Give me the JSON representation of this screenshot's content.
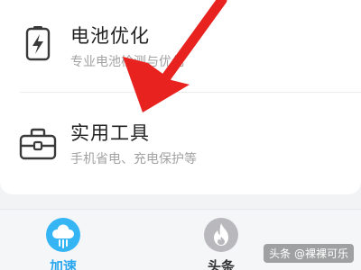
{
  "list": {
    "items": [
      {
        "title": "电池优化",
        "subtitle": "专业电池检测与优化",
        "icon": "battery-bolt-icon"
      },
      {
        "title": "实用工具",
        "subtitle": "手机省电、充电保护等",
        "icon": "toolbox-icon"
      }
    ]
  },
  "tabbar": {
    "tabs": [
      {
        "label": "加速",
        "icon": "rocket-cloud-icon",
        "active": true
      },
      {
        "label": "头条",
        "icon": "flame-icon",
        "active": false
      }
    ]
  },
  "annotation": {
    "arrow_color": "#e8231f"
  },
  "watermark": {
    "text": "头条 @裸裸可乐"
  },
  "colors": {
    "accent": "#2aa7ee",
    "title": "#222222",
    "subtitle": "#a2a2a2",
    "inactive_icon": "#b9b9bd"
  }
}
